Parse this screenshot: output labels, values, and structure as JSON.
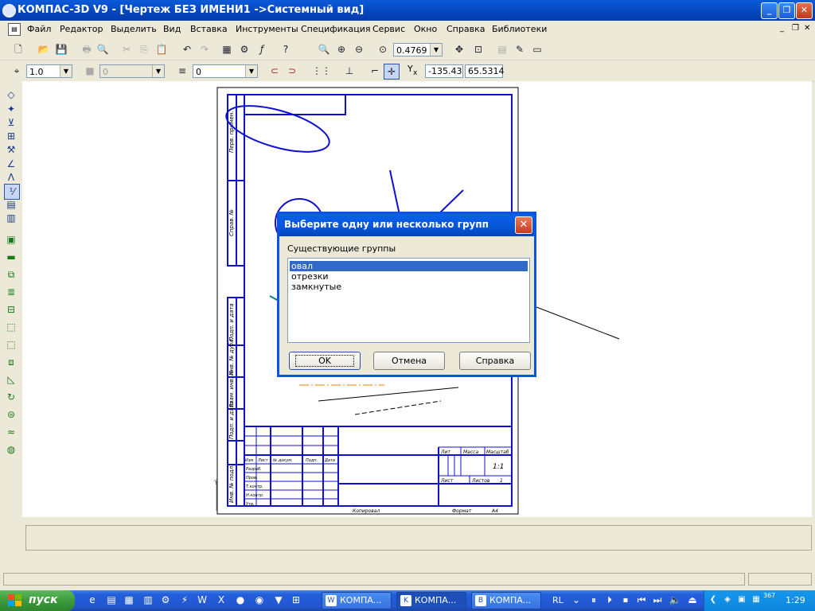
{
  "window": {
    "title": "КОМПАС-3D V9 - [Чертеж БЕЗ ИМЕНИ1 ->Системный вид]",
    "minimize": "_",
    "maximize": "❐",
    "close": "✕"
  },
  "menu": {
    "items": [
      "Файл",
      "Редактор",
      "Выделить",
      "Вид",
      "Вставка",
      "Инструменты",
      "Спецификация",
      "Сервис",
      "Окно",
      "Справка",
      "Библиотеки"
    ],
    "mdi_min": "_",
    "mdi_restore": "❐",
    "mdi_close": "✕"
  },
  "toolbar1": {
    "zoom_value": "0.4769"
  },
  "toolbar2": {
    "step_value": "1.0",
    "style_value": "0",
    "layer_value": "0",
    "x_label": "Y",
    "x_sub": "x",
    "coord_x": "-135.43",
    "coord_y": "65.5314"
  },
  "drawing": {
    "sheet_fields": {
      "lit": "Лит",
      "mass": "Масса",
      "scale": "Масштаб",
      "scale_value": "1:1",
      "sheet": "Лист",
      "sheets": "Листов",
      "sheets_value": "1",
      "copied": "Копировал",
      "format": "Формат",
      "format_value": "A4",
      "izm": "Изм",
      "list": "Лист",
      "doc_no": "№ докум.",
      "sign": "Подп.",
      "date": "Дата",
      "razrab": "Разраб.",
      "prov": "Пров.",
      "tkontr": "Т.контр.",
      "nkontr": "Н.контр.",
      "utv": "Утв."
    },
    "side_labels": [
      "Перв. примен.",
      "Справ. №",
      "Подп. и дата",
      "Инв. № дубл.",
      "Взам. инв. №",
      "Подп. и дата",
      "Инв. № подл."
    ]
  },
  "dialog": {
    "title": "Выберите одну или несколько групп",
    "close_label": "✕",
    "group_label": "Существующие группы",
    "groups": [
      "овал",
      "отрезки",
      "замкнутые"
    ],
    "selected_index": 0,
    "buttons": {
      "ok": "OK",
      "cancel": "Отмена",
      "help": "Справка"
    }
  },
  "taskbar": {
    "start_label": "пуск",
    "tasks": [
      "КОМПА...",
      "КОМПА...",
      "КОМПА..."
    ],
    "lang": "RL",
    "clock": "1:29",
    "tray_num": "367"
  },
  "colors": {
    "accent_blue": "#0a55e0",
    "drawing_blue": "#1010d0",
    "selection": "#316ac5",
    "taskbar": "#245edb"
  }
}
